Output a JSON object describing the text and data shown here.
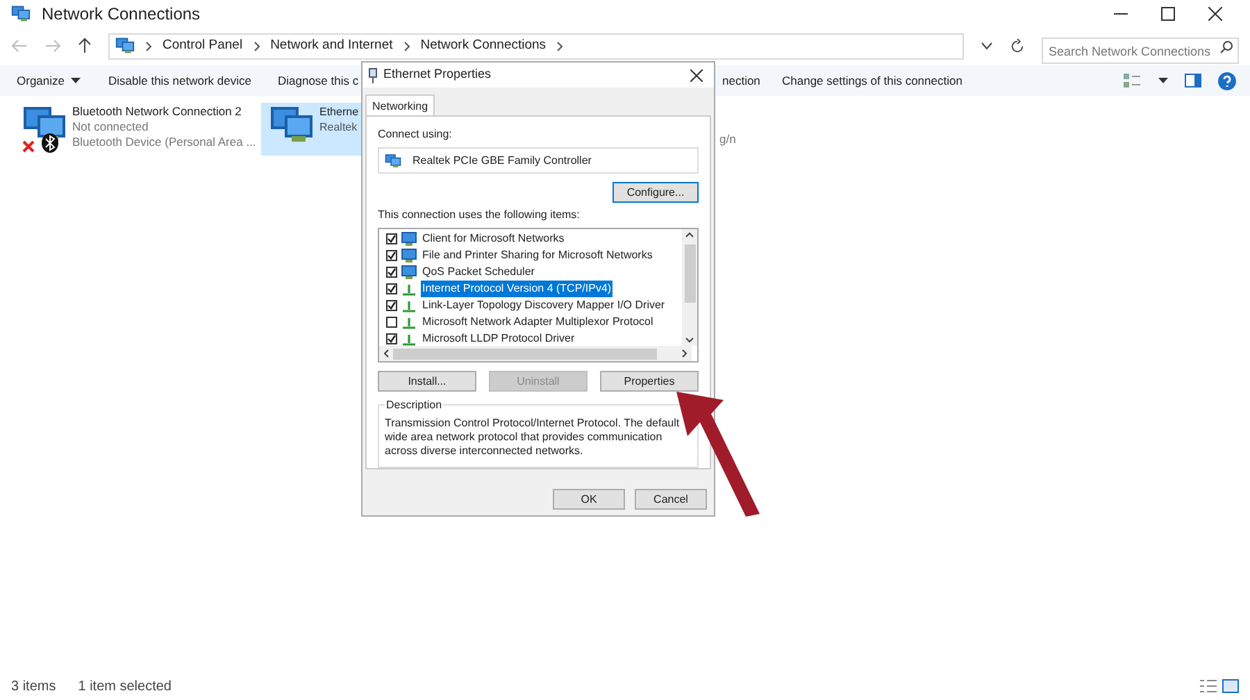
{
  "window": {
    "title": "Network Connections"
  },
  "address": {
    "crumbs": [
      "Control Panel",
      "Network and Internet",
      "Network Connections"
    ],
    "search_placeholder": "Search Network Connections"
  },
  "toolbar": {
    "items": [
      "Organize",
      "Disable this network device",
      "Diagnose this c",
      "nection",
      "Change settings of this connection"
    ]
  },
  "connections": [
    {
      "kind": "full",
      "selected": false,
      "name": "Bluetooth Network Connection 2",
      "status": "Not connected",
      "device": "Bluetooth Device (Personal Area ..."
    },
    {
      "kind": "full",
      "selected": true,
      "name": "Etherne",
      "device": "Realtek"
    },
    {
      "kind": "partial",
      "selected": false,
      "device": "g/n"
    }
  ],
  "dialog": {
    "title": "Ethernet Properties",
    "tabs": [
      {
        "label": "Networking",
        "selected": true
      }
    ],
    "connect_using_label": "Connect using:",
    "adapter": "Realtek PCIe GBE Family Controller",
    "configure": "Configure...",
    "items_label": "This connection uses the following items:",
    "items": [
      {
        "label": "Client for Microsoft Networks",
        "checked": true,
        "selected": false,
        "kind": "client"
      },
      {
        "label": "File and Printer Sharing for Microsoft Networks",
        "checked": true,
        "selected": false,
        "kind": "client"
      },
      {
        "label": "QoS Packet Scheduler",
        "checked": true,
        "selected": false,
        "kind": "client"
      },
      {
        "label": "Internet Protocol Version 4 (TCP/IPv4)",
        "checked": true,
        "selected": true,
        "kind": "protocol"
      },
      {
        "label": "Link-Layer Topology Discovery Mapper I/O Driver",
        "checked": true,
        "selected": false,
        "kind": "protocol"
      },
      {
        "label": "Microsoft Network Adapter Multiplexor Protocol",
        "checked": false,
        "selected": false,
        "kind": "protocol"
      },
      {
        "label": "Microsoft LLDP Protocol Driver",
        "checked": true,
        "selected": false,
        "kind": "protocol"
      }
    ],
    "buttons": [
      {
        "label": "Install...",
        "disabled": false
      },
      {
        "label": "Uninstall",
        "disabled": true
      },
      {
        "label": "Properties",
        "disabled": false
      }
    ],
    "description_label": "Description",
    "description": "Transmission Control Protocol/Internet Protocol. The default wide area network protocol that provides communication across diverse interconnected networks.",
    "footer_buttons": [
      "OK",
      "Cancel"
    ]
  },
  "status_bar": {
    "items": "3 items",
    "selection": "1 item selected"
  }
}
